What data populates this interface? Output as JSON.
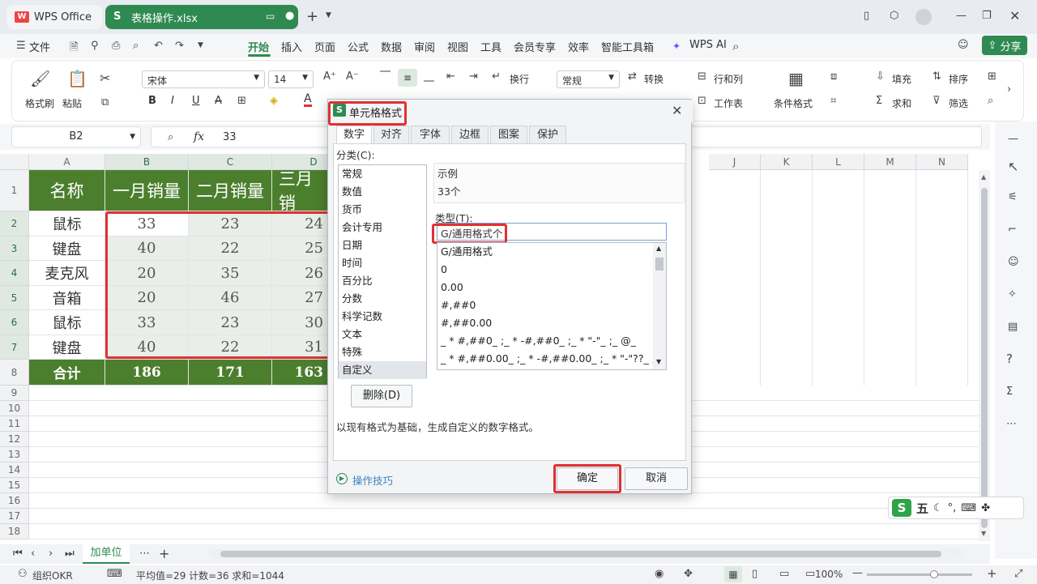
{
  "titlebar": {
    "app_tab": "WPS Office",
    "file_tab": "表格操作.xlsx"
  },
  "menubar": {
    "file_menu": "文件",
    "tabs": [
      "开始",
      "插入",
      "页面",
      "公式",
      "数据",
      "审阅",
      "视图",
      "工具",
      "会员专享",
      "效率",
      "智能工具箱"
    ],
    "active_tab": "开始",
    "wps_ai": "WPS AI",
    "share": "分享"
  },
  "ribbon": {
    "format_painter": "格式刷",
    "paste": "粘贴",
    "font_name": "宋体",
    "font_size": "14",
    "wrap": "换行",
    "number_format": "常规",
    "convert": "转换",
    "rows_cols": "行和列",
    "worksheet": "工作表",
    "conditional_format": "条件格式",
    "fill": "填充",
    "sort": "排序",
    "sum": "求和",
    "filter": "筛选",
    "merge_partial": "合并",
    "num_0000": ".000",
    "num_00": "←0"
  },
  "formulabar": {
    "cell_ref": "B2",
    "formula": "33",
    "fx": "fx"
  },
  "sheet": {
    "columns": [
      "A",
      "B",
      "C",
      "D",
      "E",
      "F",
      "G",
      "H",
      "I",
      "J",
      "K",
      "L",
      "M",
      "N"
    ],
    "rows": [
      "1",
      "2",
      "3",
      "4",
      "5",
      "6",
      "7",
      "8",
      "9",
      "10",
      "11",
      "12",
      "13",
      "14",
      "15",
      "16",
      "17",
      "18"
    ],
    "header": [
      "名称",
      "一月销量",
      "二月销量",
      "三月销"
    ],
    "data": [
      [
        "鼠标",
        "33",
        "23",
        "24"
      ],
      [
        "键盘",
        "40",
        "22",
        "25"
      ],
      [
        "麦克风",
        "20",
        "35",
        "26"
      ],
      [
        "音箱",
        "20",
        "46",
        "27"
      ],
      [
        "鼠标",
        "33",
        "23",
        "30"
      ],
      [
        "键盘",
        "40",
        "22",
        "31"
      ]
    ],
    "total": [
      "合计",
      "186",
      "171",
      "163"
    ],
    "sheet_tab": "加单位"
  },
  "status": {
    "org": "组织OKR",
    "stats": "平均值=29  计数=36  求和=1044",
    "zoom": "100%"
  },
  "dialog": {
    "title": "单元格格式",
    "tabs": [
      "数字",
      "对齐",
      "字体",
      "边框",
      "图案",
      "保护"
    ],
    "category_label": "分类(C):",
    "categories": [
      "常规",
      "数值",
      "货币",
      "会计专用",
      "日期",
      "时间",
      "百分比",
      "分数",
      "科学记数",
      "文本",
      "特殊",
      "自定义"
    ],
    "selected_category": "自定义",
    "sample_label": "示例",
    "sample_value": "33个",
    "type_label": "类型(T):",
    "type_value": "G/通用格式个",
    "formats": [
      "G/通用格式",
      "0",
      "0.00",
      "#,##0",
      "#,##0.00",
      "_ * #,##0_ ;_ * -#,##0_ ;_ * \"-\"_ ;_ @_",
      "_ * #,##0.00_ ;_ * -#,##0.00_ ;_ * \"-\"??_ ;_ @_"
    ],
    "delete_button": "删除(D)",
    "description": "以现有格式为基础，生成自定义的数字格式。",
    "tips_link": "操作技巧",
    "ok_button": "确定",
    "cancel_button": "取消"
  },
  "ime": {
    "label": "五"
  },
  "colors": {
    "accent": "#2f8a52",
    "header_fill": "#4b7f2e",
    "highlight": "#e03131"
  }
}
